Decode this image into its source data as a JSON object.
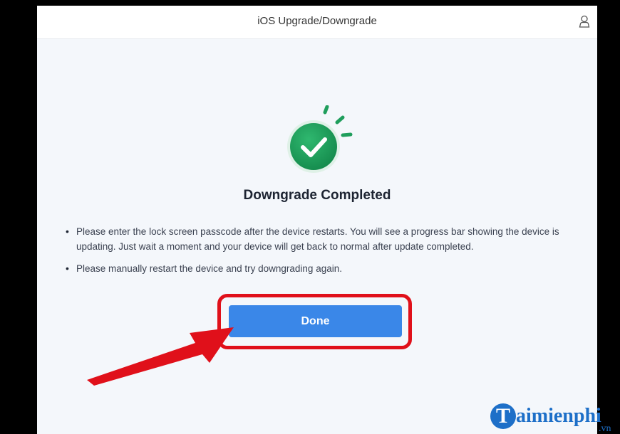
{
  "window": {
    "title": "iOS Upgrade/Downgrade",
    "icons": {
      "account": "user-icon"
    }
  },
  "main": {
    "status_icon": "success-check-icon",
    "heading": "Downgrade Completed",
    "bullets": [
      "Please enter the lock screen passcode after the device restarts. You will see a progress bar showing the device is updating. Just wait a moment and your device will get back to normal after update completed.",
      "Please manually restart the device and try downgrading again."
    ],
    "done_label": "Done"
  },
  "annotation": {
    "highlight_color": "#e0101a",
    "arrow_color": "#e0101a"
  },
  "watermark": {
    "initial": "T",
    "name": "aimienphi",
    "suffix": ".vn"
  },
  "colors": {
    "accent": "#3a87e8",
    "success": "#1f9e5c"
  }
}
